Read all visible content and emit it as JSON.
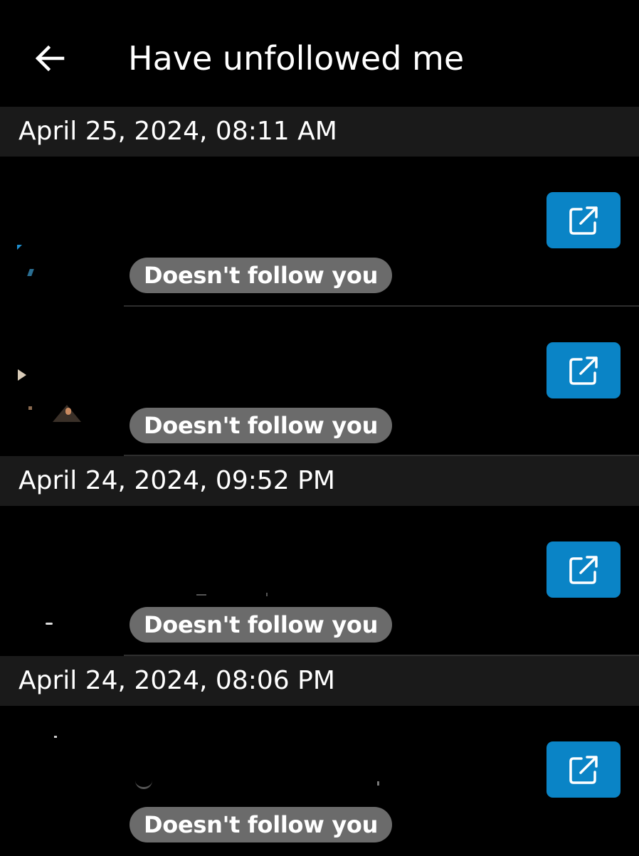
{
  "header": {
    "title": "Have unfollowed me",
    "back_icon": "arrow-left-icon"
  },
  "groups": [
    {
      "date": "April 25, 2024, 08:11 AM",
      "items": [
        {
          "status": "Doesn't follow you",
          "action_icon": "external-link-icon"
        },
        {
          "status": "Doesn't follow you",
          "action_icon": "external-link-icon"
        }
      ]
    },
    {
      "date": "April 24, 2024, 09:52 PM",
      "items": [
        {
          "status": "Doesn't follow you",
          "action_icon": "external-link-icon"
        }
      ]
    },
    {
      "date": "April 24, 2024, 08:06 PM",
      "items": [
        {
          "status": "Doesn't follow you",
          "action_icon": "external-link-icon"
        }
      ]
    }
  ],
  "colors": {
    "background": "#000000",
    "date_header_bg": "#1a1a1a",
    "badge_bg": "#6b6b6b",
    "action_button_bg": "#0a84c6",
    "text": "#ffffff"
  }
}
